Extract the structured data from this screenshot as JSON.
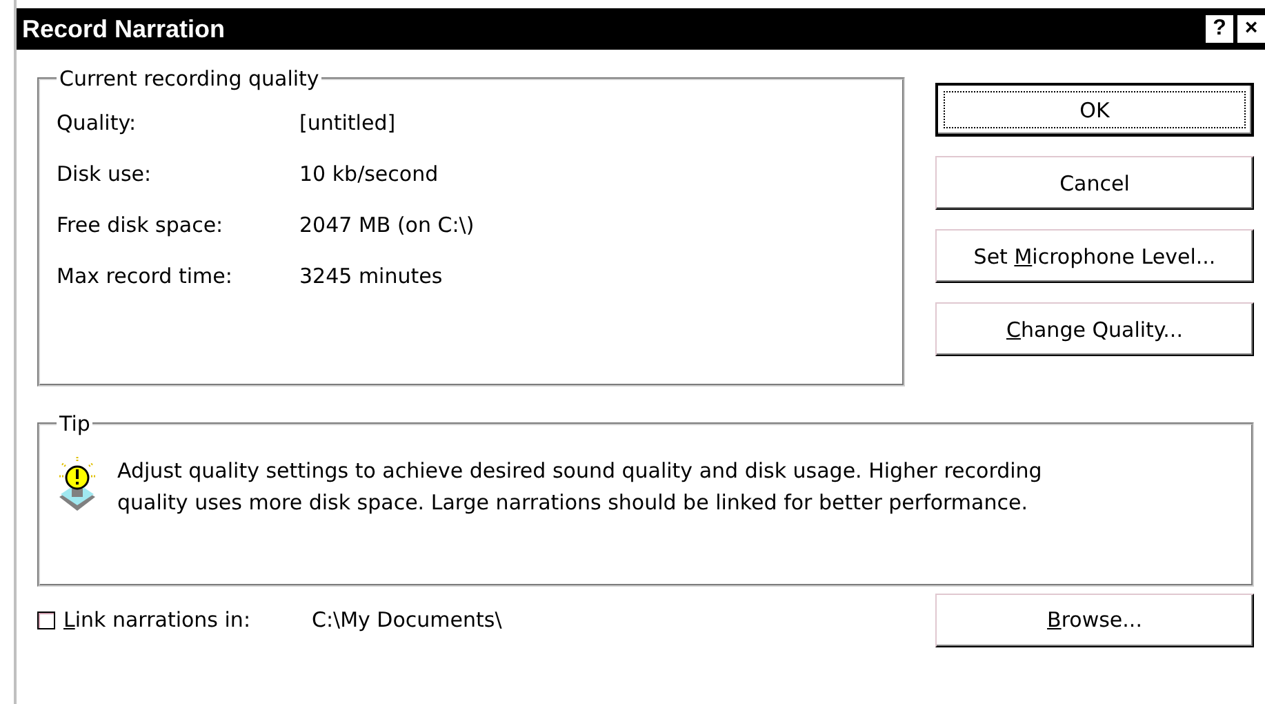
{
  "window": {
    "title": "Record Narration",
    "help_button": "?",
    "close_button": "×"
  },
  "quality_group": {
    "title": "Current recording quality",
    "rows": [
      {
        "label": "Quality:",
        "value": "[untitled]"
      },
      {
        "label": "Disk use:",
        "value": "10 kb/second"
      },
      {
        "label": "Free disk space:",
        "value": "2047 MB (on C:\\)"
      },
      {
        "label": "Max record time:",
        "value": "3245 minutes"
      }
    ]
  },
  "buttons": [
    {
      "label": [
        {
          "text": "OK",
          "underlined": false
        }
      ],
      "default": true
    },
    {
      "label": [
        {
          "text": "Cancel",
          "underlined": false
        }
      ],
      "default": false
    },
    {
      "label": [
        {
          "text": "Set ",
          "underlined": false
        },
        {
          "text": "M",
          "underlined": true
        },
        {
          "text": "icrophone Level...",
          "underlined": false
        }
      ],
      "default": false
    },
    {
      "label": [
        {
          "text": "C",
          "underlined": true
        },
        {
          "text": "hange Quality...",
          "underlined": false
        }
      ],
      "default": false
    }
  ],
  "tip": {
    "title": "Tip",
    "text": "Adjust quality settings to achieve desired sound quality and disk usage. Higher recording quality uses more disk space. Large narrations should be linked for better performance."
  },
  "link": {
    "label": [
      {
        "text": "L",
        "underlined": true
      },
      {
        "text": "ink narrations in:",
        "underlined": false
      }
    ],
    "checked": false,
    "path": "C:\\My Documents\\"
  },
  "browse_button": {
    "label": [
      {
        "text": "B",
        "underlined": true
      },
      {
        "text": "rowse...",
        "underlined": false
      }
    ]
  }
}
